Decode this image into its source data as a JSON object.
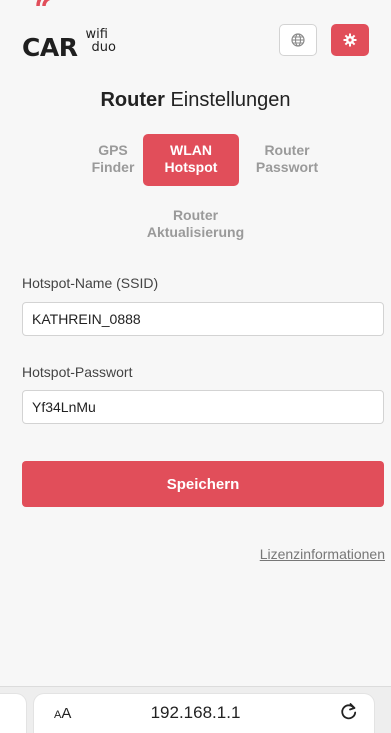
{
  "header": {
    "logo_main": "CAR",
    "logo_sub_top": "wifi",
    "logo_sub_bottom": "duo",
    "globe_icon": "globe-icon",
    "settings_icon": "gear-icon",
    "accent_color": "#e14e5a"
  },
  "page": {
    "title_bold": "Router",
    "title_rest": "Einstellungen"
  },
  "tabs": [
    {
      "line1": "GPS",
      "line2": "Finder",
      "active": false
    },
    {
      "line1": "WLAN",
      "line2": "Hotspot",
      "active": true
    },
    {
      "line1": "Router",
      "line2": "Passwort",
      "active": false
    },
    {
      "line1": "Router",
      "line2": "Aktualisierung",
      "active": false
    }
  ],
  "form": {
    "ssid_label": "Hotspot-Name (SSID)",
    "ssid_value": "KATHREIN_0888",
    "password_label": "Hotspot-Passwort",
    "password_value": "Yf34LnMu",
    "save_label": "Speichern"
  },
  "footer": {
    "license_link": "Lizenzinformationen"
  },
  "browser": {
    "text_size_label_small": "A",
    "text_size_label_large": "A",
    "url": "192.168.1.1",
    "reload_icon": "reload-icon"
  }
}
